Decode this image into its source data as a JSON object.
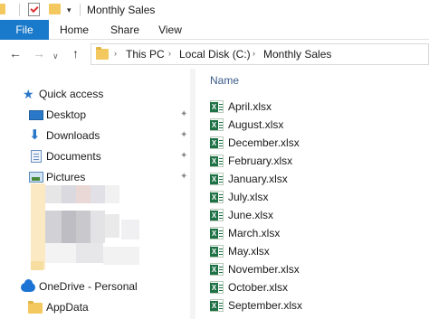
{
  "window": {
    "title": "Monthly Sales"
  },
  "quick_access_toolbar": {
    "icons": [
      "folder-icon",
      "properties-icon",
      "new-folder-icon",
      "customize-dropdown-icon"
    ],
    "dropdown_glyph": "▾"
  },
  "ribbon": {
    "tabs": [
      "File",
      "Home",
      "Share",
      "View"
    ],
    "active_tab_color": "#1979ca"
  },
  "navigation": {
    "back_glyph": "←",
    "forward_glyph": "→",
    "recent_glyph": "∨",
    "up_glyph": "↑",
    "breadcrumbs": [
      "This PC",
      "Local Disk (C:)",
      "Monthly Sales"
    ],
    "separator_glyph": "›"
  },
  "sidebar": {
    "quick_access_label": "Quick access",
    "pin_glyph": "✦",
    "items": [
      {
        "label": "Desktop",
        "icon": "desktop-icon"
      },
      {
        "label": "Downloads",
        "icon": "downloads-icon"
      },
      {
        "label": "Documents",
        "icon": "documents-icon"
      },
      {
        "label": "Pictures",
        "icon": "pictures-icon"
      }
    ],
    "onedrive_label": "OneDrive - Personal",
    "appdata_label": "AppData"
  },
  "file_list": {
    "column_name": "Name",
    "files": [
      "April.xlsx",
      "August.xlsx",
      "December.xlsx",
      "February.xlsx",
      "January.xlsx",
      "July.xlsx",
      "June.xlsx",
      "March.xlsx",
      "May.xlsx",
      "November.xlsx",
      "October.xlsx",
      "September.xlsx"
    ],
    "file_icon": "excel-file-icon",
    "excel_color": "#1e7145"
  }
}
